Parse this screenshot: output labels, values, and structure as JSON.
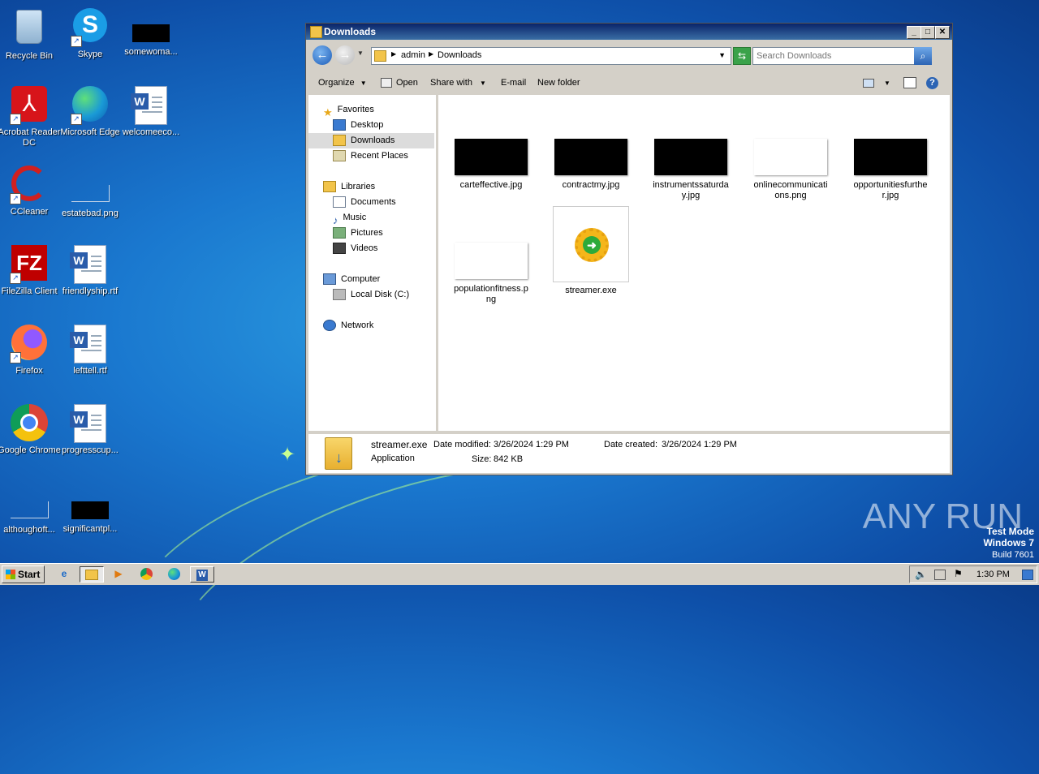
{
  "desktop": {
    "icons": [
      {
        "label": "Recycle Bin"
      },
      {
        "label": "Skype"
      },
      {
        "label": "somewoma..."
      },
      {
        "label": "Acrobat Reader DC"
      },
      {
        "label": "Microsoft Edge"
      },
      {
        "label": "welcomeeco..."
      },
      {
        "label": "CCleaner"
      },
      {
        "label": "estatebad.png"
      },
      {
        "label": "FileZilla Client"
      },
      {
        "label": "friendlyship.rtf"
      },
      {
        "label": "Firefox"
      },
      {
        "label": "lefttell.rtf"
      },
      {
        "label": "Google Chrome"
      },
      {
        "label": "progresscup..."
      },
      {
        "label": "althoughoft..."
      },
      {
        "label": "significantpl..."
      }
    ]
  },
  "window": {
    "title": "Downloads",
    "address": {
      "crumb1": "admin",
      "crumb2": "Downloads"
    },
    "search_placeholder": "Search Downloads",
    "toolbar": {
      "organize": "Organize",
      "open": "Open",
      "share_with": "Share with",
      "email": "E-mail",
      "new_folder": "New folder"
    },
    "nav": {
      "favorites": "Favorites",
      "desktop": "Desktop",
      "downloads": "Downloads",
      "recent": "Recent Places",
      "libraries": "Libraries",
      "documents": "Documents",
      "music": "Music",
      "pictures": "Pictures",
      "videos": "Videos",
      "computer": "Computer",
      "local_disk": "Local Disk (C:)",
      "network": "Network"
    },
    "files": [
      {
        "name": "carteffective.jpg"
      },
      {
        "name": "contractmy.jpg"
      },
      {
        "name": "instrumentssaturday.jpg"
      },
      {
        "name": "onlinecommunications.png"
      },
      {
        "name": "opportunitiesfurther.jpg"
      },
      {
        "name": "populationfitness.png"
      },
      {
        "name": "streamer.exe"
      }
    ],
    "details": {
      "name": "streamer.exe",
      "type": "Application",
      "modified_label": "Date modified:",
      "modified_value": "3/26/2024 1:29 PM",
      "created_label": "Date created:",
      "created_value": "3/26/2024 1:29 PM",
      "size_label": "Size:",
      "size_value": "842 KB"
    }
  },
  "taskbar": {
    "start": "Start",
    "clock": "1:30 PM"
  },
  "watermark": {
    "brand": "ANY RUN",
    "line1": "Test Mode",
    "line2": "Windows 7",
    "line3": "Build 7601"
  }
}
